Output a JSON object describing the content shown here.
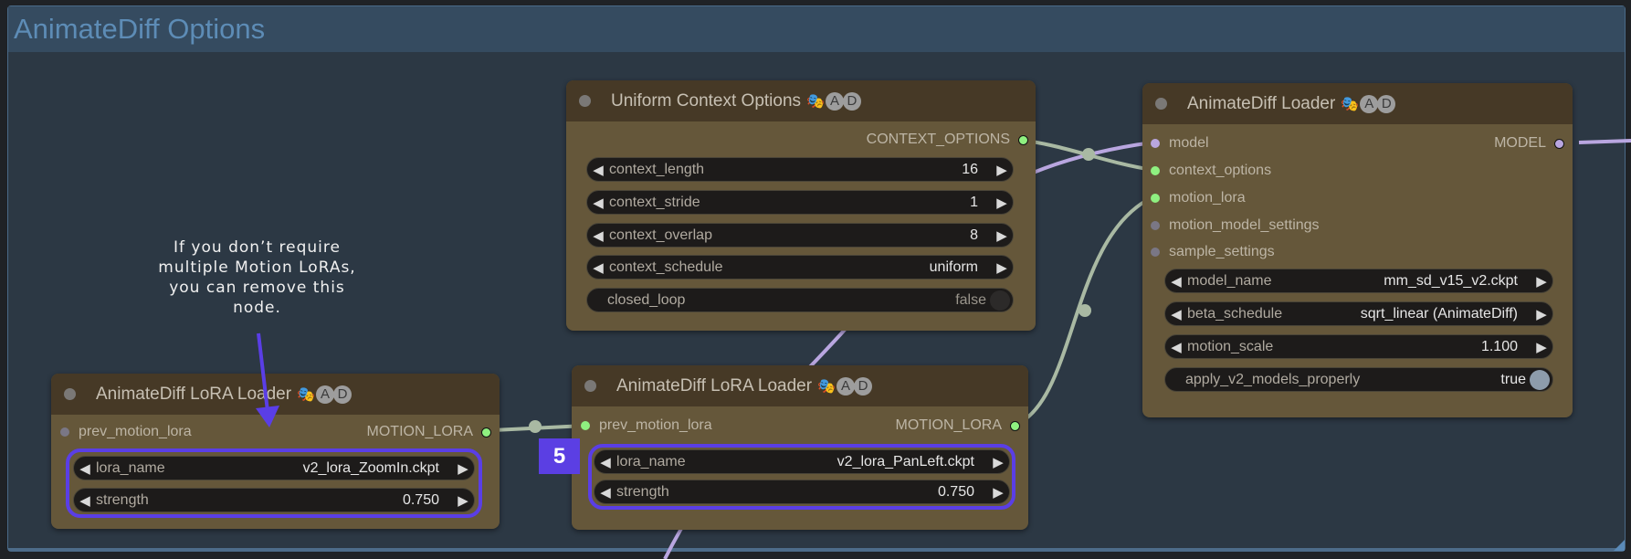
{
  "group": {
    "title": "AnimateDiff Options"
  },
  "colors": {
    "group_bg": "#2c3844",
    "group_title": "#5d8cb6",
    "node_bg": "#65573a",
    "node_header": "#463926",
    "link_green": "#a9b9a3",
    "link_purple": "#b9a6e0",
    "slot_green": "#8ff080",
    "highlight": "#5a3ee6"
  },
  "title_badges": {
    "mask": "🎭",
    "a": "A",
    "d": "D"
  },
  "annotation": {
    "note": "If you don’t require multiple Motion LoRAs, you can remove this node.",
    "step_badge": "5"
  },
  "nodes": {
    "uniform_context": {
      "title": "Uniform Context Options",
      "output": "CONTEXT_OPTIONS",
      "widgets": [
        {
          "label": "context_length",
          "value": "16"
        },
        {
          "label": "context_stride",
          "value": "1"
        },
        {
          "label": "context_overlap",
          "value": "8"
        },
        {
          "label": "context_schedule",
          "value": "uniform"
        }
      ],
      "toggle": {
        "label": "closed_loop",
        "value": "false"
      }
    },
    "animatediff_loader": {
      "title": "AnimateDiff Loader",
      "inputs": [
        "model",
        "context_options",
        "motion_lora",
        "motion_model_settings",
        "sample_settings"
      ],
      "output": "MODEL",
      "widgets": [
        {
          "label": "model_name",
          "value": "mm_sd_v15_v2.ckpt"
        },
        {
          "label": "beta_schedule",
          "value": "sqrt_linear (AnimateDiff)"
        },
        {
          "label": "motion_scale",
          "value": "1.100"
        }
      ],
      "toggle": {
        "label": "apply_v2_models_properly",
        "value": "true"
      }
    },
    "lora_loader_1": {
      "title": "AnimateDiff LoRA Loader",
      "input": "prev_motion_lora",
      "output": "MOTION_LORA",
      "widgets": [
        {
          "label": "lora_name",
          "value": "v2_lora_ZoomIn.ckpt"
        },
        {
          "label": "strength",
          "value": "0.750"
        }
      ]
    },
    "lora_loader_2": {
      "title": "AnimateDiff LoRA Loader",
      "input": "prev_motion_lora",
      "output": "MOTION_LORA",
      "widgets": [
        {
          "label": "lora_name",
          "value": "v2_lora_PanLeft.ckpt"
        },
        {
          "label": "strength",
          "value": "0.750"
        }
      ]
    }
  }
}
